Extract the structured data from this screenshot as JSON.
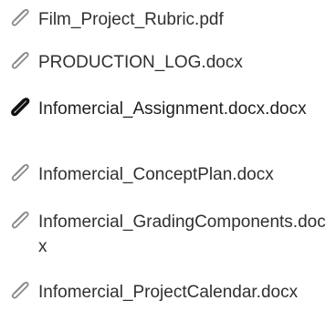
{
  "attachments": {
    "items": [
      {
        "filename": "Film_Project_Rubric.pdf",
        "icon": "paperclip-icon",
        "selected": false
      },
      {
        "filename": "PRODUCTION_LOG.docx",
        "icon": "paperclip-icon",
        "selected": false
      },
      {
        "filename": "Infomercial_Assignment.docx.docx",
        "icon": "paperclip-icon",
        "selected": true
      },
      {
        "filename": "Infomercial_ConceptPlan.docx",
        "icon": "paperclip-icon",
        "selected": false
      },
      {
        "filename": "Infomercial_GradingComponents.docx",
        "icon": "paperclip-icon",
        "selected": false
      },
      {
        "filename": "Infomercial_ProjectCalendar.docx",
        "icon": "paperclip-icon",
        "selected": false
      }
    ]
  },
  "colors": {
    "text": "#303030",
    "icon_outline": "#8a8a8a",
    "icon_selected": "#111111",
    "background": "#ffffff"
  }
}
